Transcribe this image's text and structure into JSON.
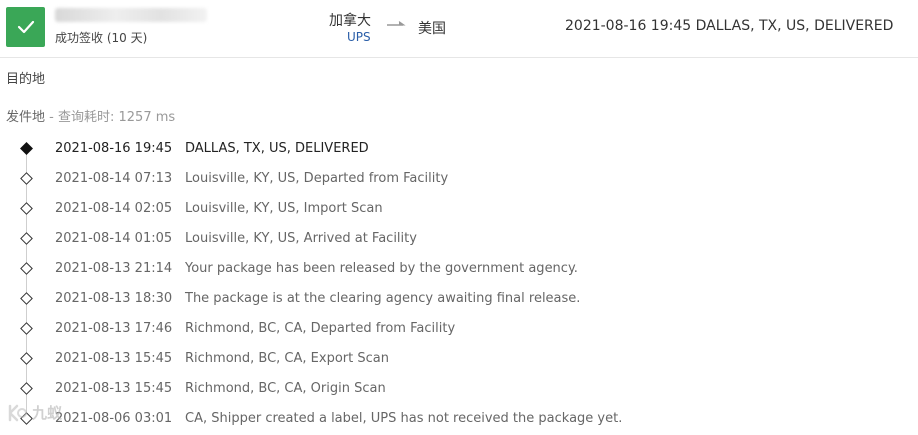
{
  "header": {
    "status_icon": "check-icon",
    "status_color": "#3aa757",
    "status_text": "成功签收 (10 天)",
    "origin_country": "加拿大",
    "carrier": "UPS",
    "destination_country": "美国",
    "latest_event": "2021-08-16 19:45  DALLAS, TX, US, DELIVERED"
  },
  "sections": {
    "destination_label": "目的地",
    "origin_label": "发件地",
    "query_time_label": "查询耗时:",
    "query_time_value": "1257 ms"
  },
  "events": [
    {
      "time": "2021-08-16 19:45",
      "desc": "DALLAS, TX, US, DELIVERED"
    },
    {
      "time": "2021-08-14 07:13",
      "desc": "Louisville, KY, US, Departed from Facility"
    },
    {
      "time": "2021-08-14 02:05",
      "desc": "Louisville, KY, US, Import Scan"
    },
    {
      "time": "2021-08-14 01:05",
      "desc": "Louisville, KY, US, Arrived at Facility"
    },
    {
      "time": "2021-08-13 21:14",
      "desc": "Your package has been released by the government agency."
    },
    {
      "time": "2021-08-13 18:30",
      "desc": "The package is at the clearing agency awaiting final release."
    },
    {
      "time": "2021-08-13 17:46",
      "desc": "Richmond, BC, CA, Departed from Facility"
    },
    {
      "time": "2021-08-13 15:45",
      "desc": "Richmond, BC, CA, Export Scan"
    },
    {
      "time": "2021-08-13 15:45",
      "desc": "Richmond, BC, CA, Origin Scan"
    },
    {
      "time": "2021-08-06 03:01",
      "desc": "CA, Shipper created a label, UPS has not received the package yet."
    }
  ],
  "watermark": {
    "text": "九蚁"
  }
}
